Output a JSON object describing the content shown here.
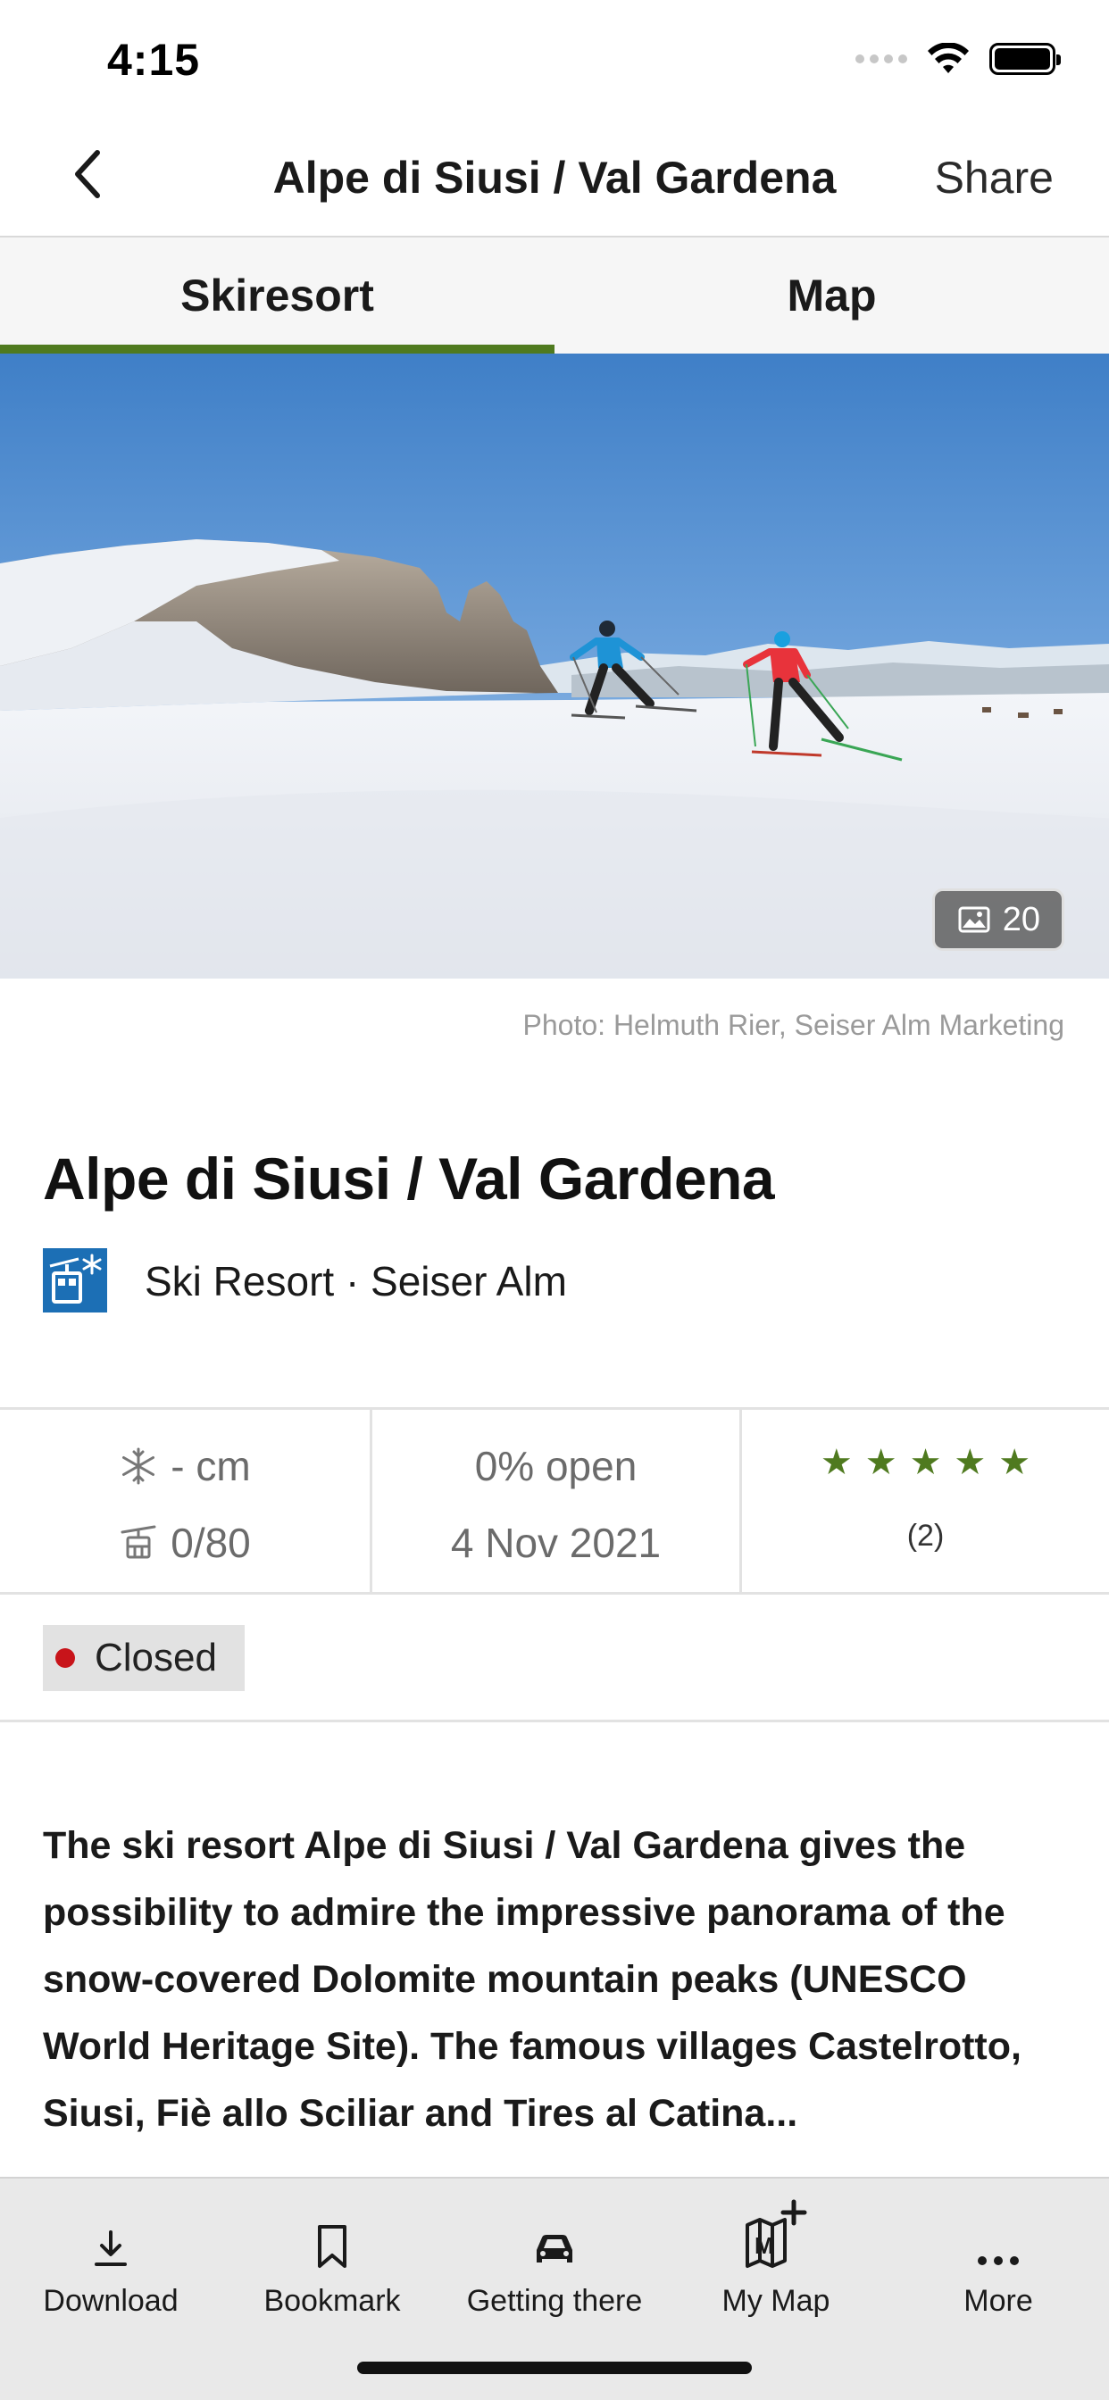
{
  "status_bar": {
    "time": "4:15"
  },
  "nav": {
    "title": "Alpe di Siusi / Val Gardena",
    "share_label": "Share"
  },
  "tabs": [
    {
      "label": "Skiresort",
      "active": true
    },
    {
      "label": "Map",
      "active": false
    }
  ],
  "hero": {
    "photo_count": "20",
    "credit": "Photo: Helmuth Rier, Seiser Alm Marketing"
  },
  "resort": {
    "title": "Alpe di Siusi / Val Gardena",
    "subtitle": "Ski Resort · Seiser Alm",
    "icon": "cable-car-snowflake-icon"
  },
  "stats": {
    "snow": "- cm",
    "lifts": "0/80",
    "open": "0% open",
    "date": "4 Nov 2021",
    "stars": 5,
    "reviews": "(2)"
  },
  "status": {
    "label": "Closed",
    "color": "#c8141a"
  },
  "description": "The ski resort Alpe di Siusi / Val Gardena gives the possibility to admire the impressive panorama of the snow-covered Dolomite mountain peaks (UNESCO World Heritage Site). The famous villages Castelrotto, Siusi, Fiè allo Sciliar and Tires al Catina...",
  "toolbar": {
    "download": "Download",
    "bookmark": "Bookmark",
    "getting_there": "Getting there",
    "my_map": "My Map",
    "more": "More"
  },
  "colors": {
    "accent": "#4f7a1f",
    "brand_blue": "#1c6fb5"
  }
}
